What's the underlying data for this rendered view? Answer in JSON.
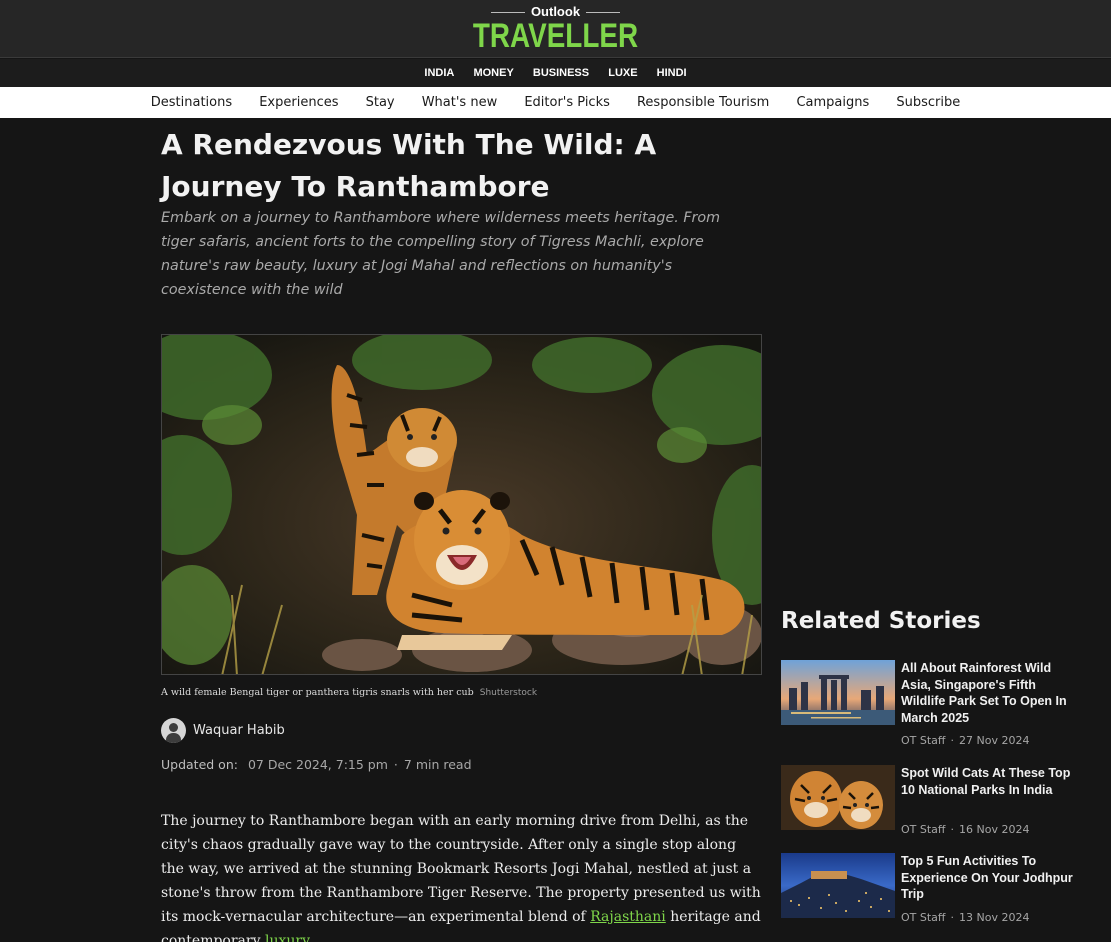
{
  "header": {
    "logo_top": "Outlook",
    "logo_main": "TRAVELLER",
    "logo_color": "#7fd64a",
    "subnav": [
      "INDIA",
      "MONEY",
      "BUSINESS",
      "LUXE",
      "HINDI"
    ],
    "mainnav": [
      "Destinations",
      "Experiences",
      "Stay",
      "What's new",
      "Editor's Picks",
      "Responsible Tourism",
      "Campaigns",
      "Subscribe"
    ]
  },
  "article": {
    "title": "A Rendezvous With The Wild: A Journey To Ranthambore",
    "dek": "Embark on a journey to Ranthambore where wilderness meets heritage. From tiger safaris, ancient forts to the compelling story of Tigress Machli, explore nature's raw beauty, luxury at Jogi Mahal and reflections on humanity's coexistence with the wild",
    "caption": "A wild female Bengal tiger or panthera tigris snarls with her cub",
    "credit": "Shutterstock",
    "author": "Waquar Habib",
    "updated_label": "Updated on:",
    "updated": "07 Dec 2024, 7:15 pm",
    "read_time": "7 min read",
    "body_start": "The journey to Ranthambore began with an early morning drive from Delhi, as the city's chaos gradually gave way to the countryside. After only a single stop along the way, we arrived at the stunning Bookmark Resorts Jogi Mahal, nestled at just a stone's throw from the Ranthambore Tiger Reserve. The property presented us with its mock-vernacular architecture—an experimental blend of ",
    "link1": "Rajasthani",
    "body_mid": " heritage and contemporary ",
    "link2": "luxury",
    "body_end": "."
  },
  "related": {
    "heading": "Related Stories",
    "stories": [
      {
        "title": "All About Rainforest Wild Asia, Singapore's Fifth Wildlife Park Set To Open In March 2025",
        "author": "OT Staff",
        "date": "27 Nov 2024",
        "thumb_icon": "singapore-skyline-thumbnail"
      },
      {
        "title": "Spot Wild Cats At These Top 10 National Parks In India",
        "author": "OT Staff",
        "date": "16 Nov 2024",
        "thumb_icon": "tigers-thumbnail"
      },
      {
        "title": "Top 5 Fun Activities To Experience On Your Jodhpur Trip",
        "author": "OT Staff",
        "date": "13 Nov 2024",
        "thumb_icon": "jodhpur-night-thumbnail"
      }
    ]
  }
}
